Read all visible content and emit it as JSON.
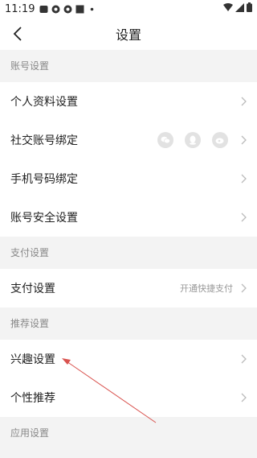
{
  "status_bar": {
    "time": "11:19"
  },
  "header": {
    "title": "设置"
  },
  "sections": {
    "account": {
      "title": "账号设置",
      "items": [
        {
          "label": "个人资料设置"
        },
        {
          "label": "社交账号绑定",
          "icons": [
            "wechat-icon",
            "qq-icon",
            "weibo-icon"
          ]
        },
        {
          "label": "手机号码绑定"
        },
        {
          "label": "账号安全设置"
        }
      ]
    },
    "payment": {
      "title": "支付设置",
      "items": [
        {
          "label": "支付设置",
          "hint": "开通快捷支付"
        }
      ]
    },
    "recommend": {
      "title": "推荐设置",
      "items": [
        {
          "label": "兴趣设置"
        },
        {
          "label": "个性推荐"
        }
      ]
    },
    "app": {
      "title": "应用设置"
    }
  },
  "colors": {
    "background": "#f3f3f3",
    "annotation_arrow": "#d9534f"
  }
}
